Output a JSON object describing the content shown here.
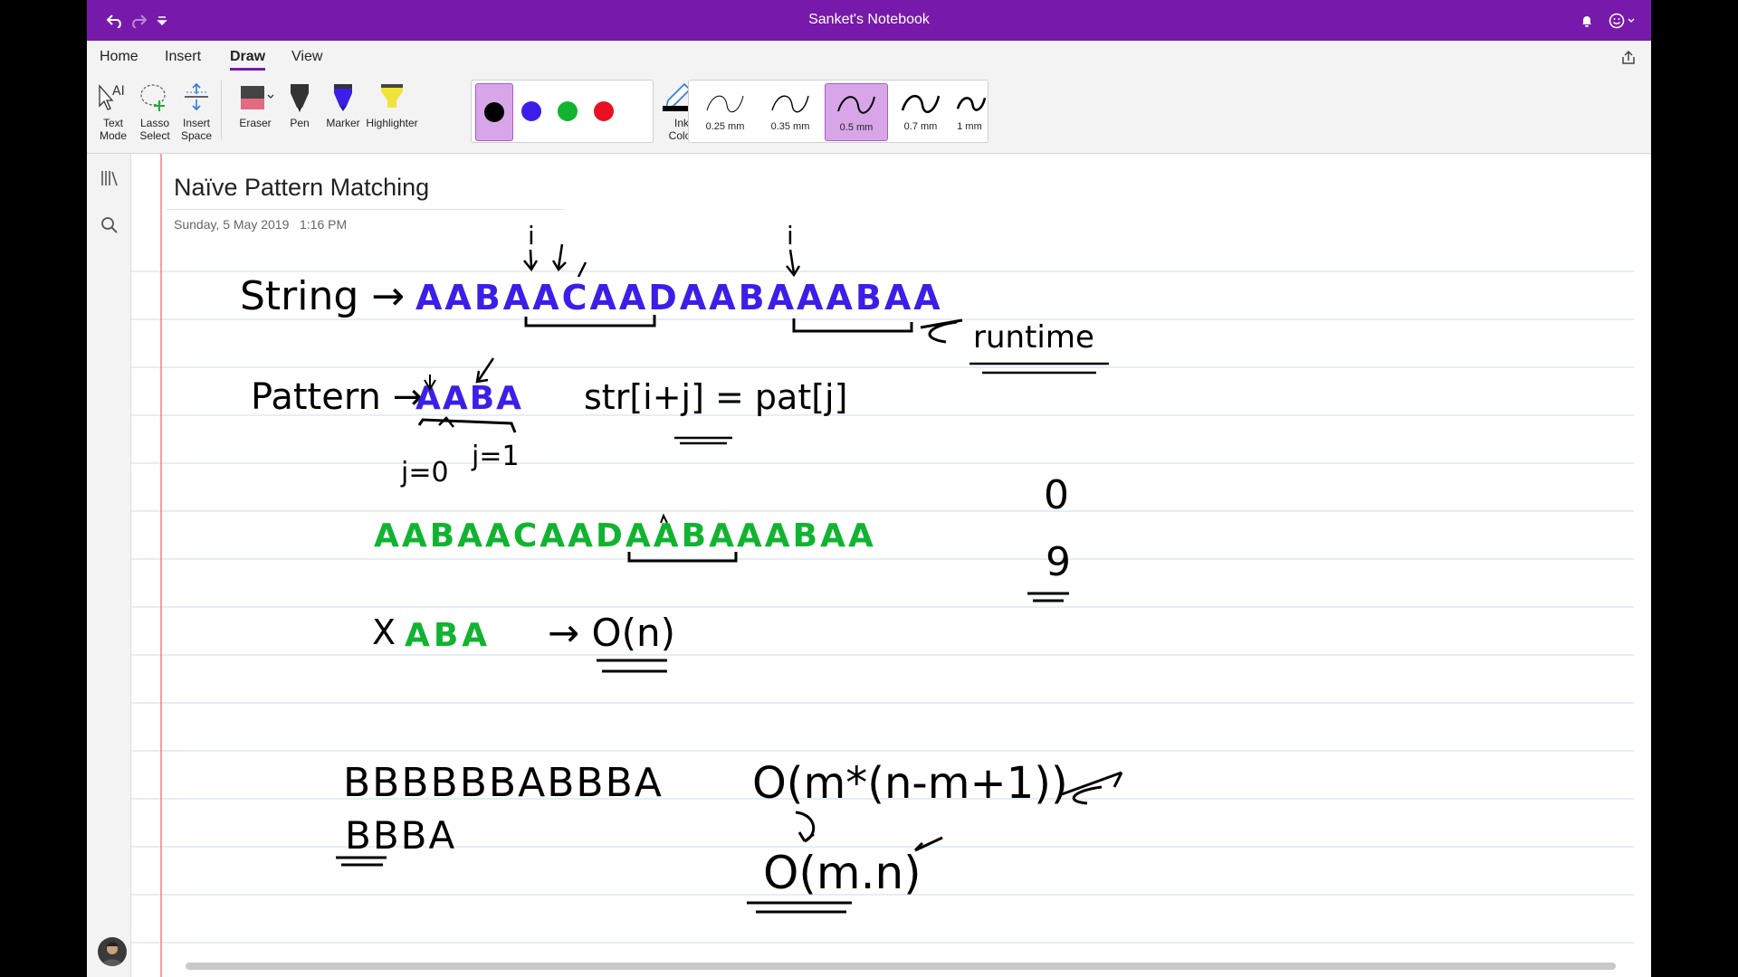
{
  "app": {
    "window_title": "Sanket's Notebook"
  },
  "tabs": [
    {
      "label": "Home",
      "active": false
    },
    {
      "label": "Insert",
      "active": false
    },
    {
      "label": "Draw",
      "active": true
    },
    {
      "label": "View",
      "active": false
    }
  ],
  "ribbon": {
    "text_mode": "Text\nMode",
    "lasso_select": "Lasso\nSelect",
    "insert_space": "Insert\nSpace",
    "eraser": "Eraser",
    "pen": "Pen",
    "marker": "Marker",
    "highlighter": "Highlighter",
    "ink_color": "Ink\nColor",
    "colors": [
      {
        "name": "black",
        "hex": "#000000",
        "selected": true
      },
      {
        "name": "blue",
        "hex": "#3b1fe8",
        "selected": false
      },
      {
        "name": "green",
        "hex": "#11b330",
        "selected": false
      },
      {
        "name": "red",
        "hex": "#e81123",
        "selected": false
      }
    ],
    "thicknesses": [
      {
        "label": "0.25 mm",
        "selected": false
      },
      {
        "label": "0.35 mm",
        "selected": false
      },
      {
        "label": "0.5 mm",
        "selected": true
      },
      {
        "label": "0.7 mm",
        "selected": false
      },
      {
        "label": "1 mm",
        "selected": false
      }
    ],
    "selected_accent": "#d8a6e8"
  },
  "page": {
    "title": "Naïve Pattern Matching",
    "date": "Sunday, 5 May 2019",
    "time": "1:16 PM"
  },
  "ink": {
    "string_label": "String →",
    "string_value": "AABAACAADAABAAABAA",
    "runtime_note": "runtime",
    "pattern_label": "Pattern →",
    "pattern_value": "AABA",
    "index_i": "i",
    "index_j": "j=0",
    "index_j2": "j=1",
    "compare_expr": "str[i+j] = pat[j]",
    "row_green": "AABAACAADAABAAABAA",
    "row_green_pattern": "ABA",
    "x_mark": "X",
    "on_label": "→ O(n)",
    "side_zero": "0",
    "side_nine": "9",
    "row_b_text": "BBBBBBABBBA",
    "row_b_pattern": "BBBA",
    "complexity1": "O(m*(n-m+1))",
    "complexity2": "O(m.n)"
  }
}
